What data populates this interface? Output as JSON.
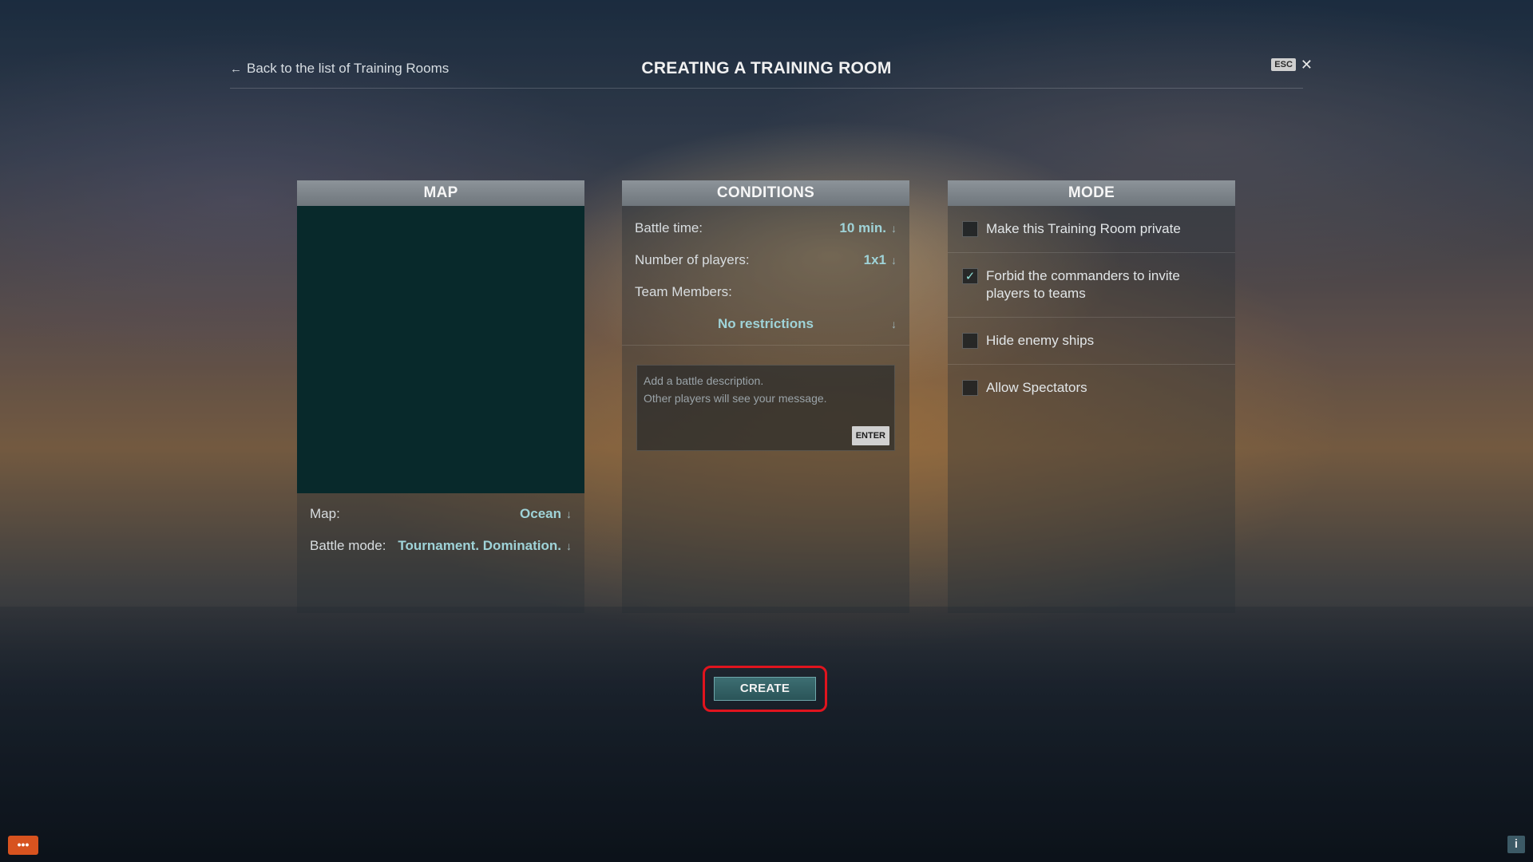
{
  "header": {
    "back_label": "Back to the list of Training Rooms",
    "title": "CREATING A TRAINING ROOM",
    "esc_label": "ESC",
    "close_glyph": "✕"
  },
  "map_panel": {
    "title": "MAP",
    "map_label": "Map:",
    "map_value": "Ocean",
    "battle_mode_label": "Battle mode:",
    "battle_mode_value": "Tournament. Domination."
  },
  "conditions_panel": {
    "title": "CONDITIONS",
    "battle_time_label": "Battle time:",
    "battle_time_value": "10 min.",
    "players_label": "Number of players:",
    "players_value": "1x1",
    "team_members_label": "Team Members:",
    "team_members_value": "No restrictions",
    "description_placeholder": "Add a battle description.\nOther players will see your message.",
    "enter_label": "ENTER"
  },
  "mode_panel": {
    "title": "MODE",
    "options": [
      {
        "label": "Make this Training Room private",
        "checked": false
      },
      {
        "label": "Forbid the commanders to invite players to teams",
        "checked": true
      },
      {
        "label": "Hide enemy ships",
        "checked": false
      },
      {
        "label": "Allow Spectators",
        "checked": false
      }
    ]
  },
  "actions": {
    "create_label": "CREATE"
  },
  "footer": {
    "chat_glyph": "•••",
    "info_glyph": "i"
  },
  "icons": {
    "back": "arrow-left-icon",
    "dropdown": "arrow-down-icon",
    "check": "check-icon",
    "chat": "chat-icon",
    "info": "info-icon"
  },
  "colors": {
    "accent_value": "#9fd3d8",
    "create_button": "#2f5f63",
    "highlight": "#e0141e",
    "chat_button": "#d7531f"
  }
}
